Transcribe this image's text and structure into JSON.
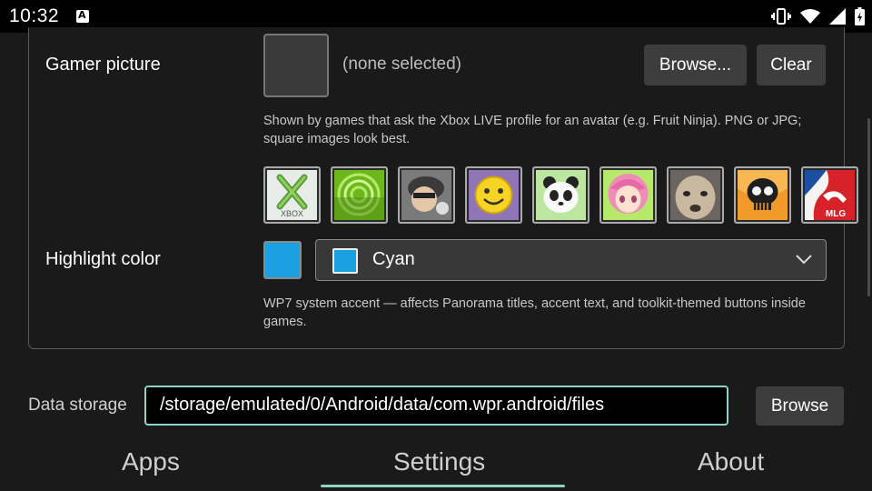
{
  "status_bar": {
    "time": "10:32",
    "notification_icon": "a-box-icon",
    "icons": [
      "vibrate-icon",
      "wifi-icon",
      "signal-icon",
      "battery-charging-icon"
    ]
  },
  "gamer_picture": {
    "label": "Gamer picture",
    "none_selected": "(none selected)",
    "browse_label": "Browse...",
    "clear_label": "Clear",
    "help": "Shown by games that ask the Xbox LIVE profile for an avatar (e.g. Fruit Ninja). PNG or JPG; square images look best.",
    "preset_avatars": [
      {
        "name": "xbox",
        "text": "XBOX"
      },
      {
        "name": "green-rings",
        "text": ""
      },
      {
        "name": "cartoon-kid",
        "text": ""
      },
      {
        "name": "smiley",
        "text": ""
      },
      {
        "name": "panda",
        "text": ""
      },
      {
        "name": "anime-girl",
        "text": ""
      },
      {
        "name": "dog",
        "text": ""
      },
      {
        "name": "skull",
        "text": ""
      },
      {
        "name": "mlg",
        "text": "MLG"
      }
    ]
  },
  "highlight_color": {
    "label": "Highlight color",
    "selected": "Cyan",
    "color": "#1ba1e2",
    "help": "WP7 system accent — affects Panorama titles, accent text, and toolkit-themed buttons inside games."
  },
  "data_storage": {
    "label": "Data storage",
    "path": "/storage/emulated/0/Android/data/com.wpr.android/files",
    "browse_label": "Browse"
  },
  "tabs": [
    {
      "label": "Apps",
      "active": false
    },
    {
      "label": "Settings",
      "active": true
    },
    {
      "label": "About",
      "active": false
    }
  ],
  "colors": {
    "accent": "#8ed3c6",
    "highlight": "#1ba1e2",
    "background": "#1a1a1a"
  }
}
